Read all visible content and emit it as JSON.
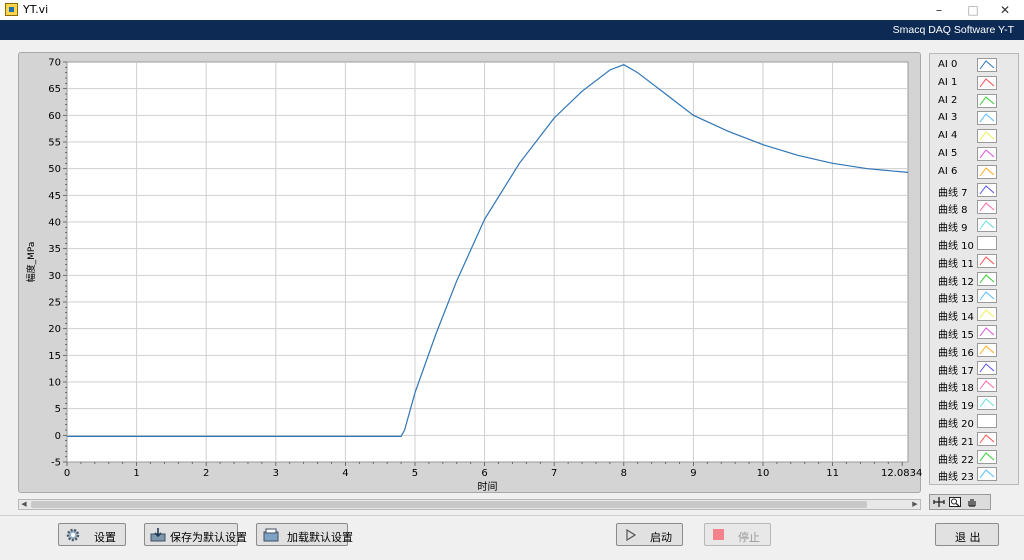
{
  "window": {
    "title": "YT.vi",
    "minimize_icon": "–",
    "maximize_icon": "□",
    "close_icon": "✕"
  },
  "banner": {
    "text": "Smacq DAQ Software Y-T"
  },
  "chart_data": {
    "type": "line",
    "xlabel": "时间",
    "ylabel": "幅度_MPa",
    "xlim": [
      0,
      12.083464
    ],
    "ylim": [
      -5,
      70
    ],
    "grid": true,
    "x_ticks": [
      "0",
      "1",
      "2",
      "3",
      "4",
      "5",
      "6",
      "7",
      "8",
      "9",
      "10",
      "11",
      "12.083464"
    ],
    "y_ticks": [
      "70",
      "65",
      "60",
      "55",
      "50",
      "45",
      "40",
      "35",
      "30",
      "25",
      "20",
      "15",
      "10",
      "5",
      "0",
      "-5"
    ],
    "line_color": "#2e75b6",
    "series": [
      {
        "x": [
          0,
          1,
          2,
          3,
          4,
          4.8,
          4.85,
          5.0,
          5.3,
          5.6,
          6.0,
          6.5,
          7.0,
          7.4,
          7.8,
          8.0,
          8.2,
          8.6,
          9.0,
          9.5,
          10.0,
          10.5,
          11.0,
          11.5,
          12.083464
        ],
        "y": [
          -0.2,
          -0.2,
          -0.2,
          -0.2,
          -0.2,
          -0.2,
          1.0,
          8.0,
          19.0,
          29.0,
          40.5,
          51.0,
          59.5,
          64.5,
          68.5,
          69.5,
          68.0,
          64.0,
          60.0,
          57.0,
          54.5,
          52.5,
          51.0,
          50.0,
          49.3
        ]
      }
    ]
  },
  "legend": {
    "items": [
      {
        "label": "AI 0",
        "color": "#2e75b6"
      },
      {
        "label": "AI 1",
        "color": "#ff4d4d"
      },
      {
        "label": "AI 2",
        "color": "#33cc33"
      },
      {
        "label": "AI 3",
        "color": "#55bbff"
      },
      {
        "label": "AI 4",
        "color": "#eeee55"
      },
      {
        "label": "AI 5",
        "color": "#dd55dd"
      },
      {
        "label": "AI 6",
        "color": "#ffaa22"
      },
      {
        "label": "曲线 7",
        "color": "#5555ee"
      },
      {
        "label": "曲线 8",
        "color": "#ff66aa"
      },
      {
        "label": "曲线 9",
        "color": "#66dddd"
      },
      {
        "label": "曲线 10",
        "color": "#ffffff"
      },
      {
        "label": "曲线 11",
        "color": "#ff4d4d"
      },
      {
        "label": "曲线 12",
        "color": "#33cc33"
      },
      {
        "label": "曲线 13",
        "color": "#55bbff"
      },
      {
        "label": "曲线 14",
        "color": "#eeee55"
      },
      {
        "label": "曲线 15",
        "color": "#dd55dd"
      },
      {
        "label": "曲线 16",
        "color": "#ffaa22"
      },
      {
        "label": "曲线 17",
        "color": "#5555ee"
      },
      {
        "label": "曲线 18",
        "color": "#ff66aa"
      },
      {
        "label": "曲线 19",
        "color": "#66dddd"
      },
      {
        "label": "曲线 20",
        "color": "#ffffff"
      },
      {
        "label": "曲线 21",
        "color": "#ff4d4d"
      },
      {
        "label": "曲线 22",
        "color": "#33cc33"
      },
      {
        "label": "曲线 23",
        "color": "#55bbff"
      }
    ]
  },
  "scrollbar": {
    "left_arrow": "◀",
    "right_arrow": "▶"
  },
  "buttons": {
    "settings": "设置",
    "save_default": "保存为默认设置",
    "load_default": "加载默认设置",
    "start": "启动",
    "stop": "停止",
    "exit": "退 出"
  }
}
